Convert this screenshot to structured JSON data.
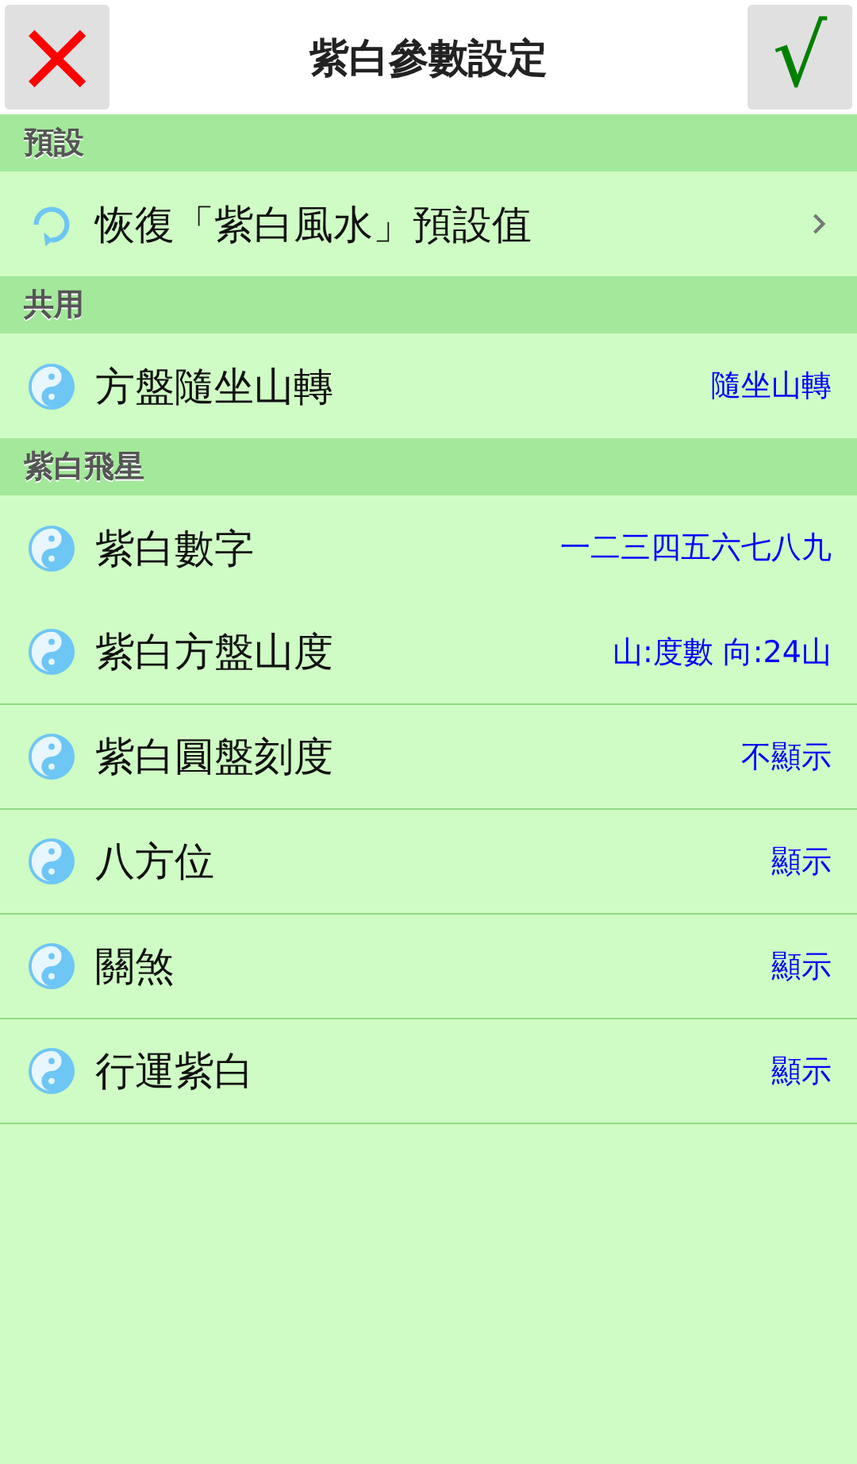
{
  "header": {
    "cancel": "×",
    "title": "紫白參數設定",
    "confirm": "√"
  },
  "sections": [
    {
      "title": "預設",
      "items": [
        {
          "kind": "action",
          "label": "恢復「紫白風水」預設值"
        }
      ]
    },
    {
      "title": "共用",
      "items": [
        {
          "kind": "setting",
          "label": "方盤隨坐山轉",
          "value": "隨坐山轉"
        }
      ]
    },
    {
      "title": "紫白飛星",
      "items": [
        {
          "kind": "setting",
          "label": "紫白數字",
          "value": "一二三四五六七八九"
        },
        {
          "kind": "setting",
          "label": "紫白方盤山度",
          "value": "山:度數 向:24山"
        },
        {
          "kind": "setting",
          "label": "紫白圓盤刻度",
          "value": "不顯示"
        },
        {
          "kind": "setting",
          "label": "八方位",
          "value": "顯示"
        },
        {
          "kind": "setting",
          "label": "關煞",
          "value": "顯示"
        },
        {
          "kind": "setting",
          "label": "行運紫白",
          "value": "顯示"
        }
      ]
    }
  ]
}
